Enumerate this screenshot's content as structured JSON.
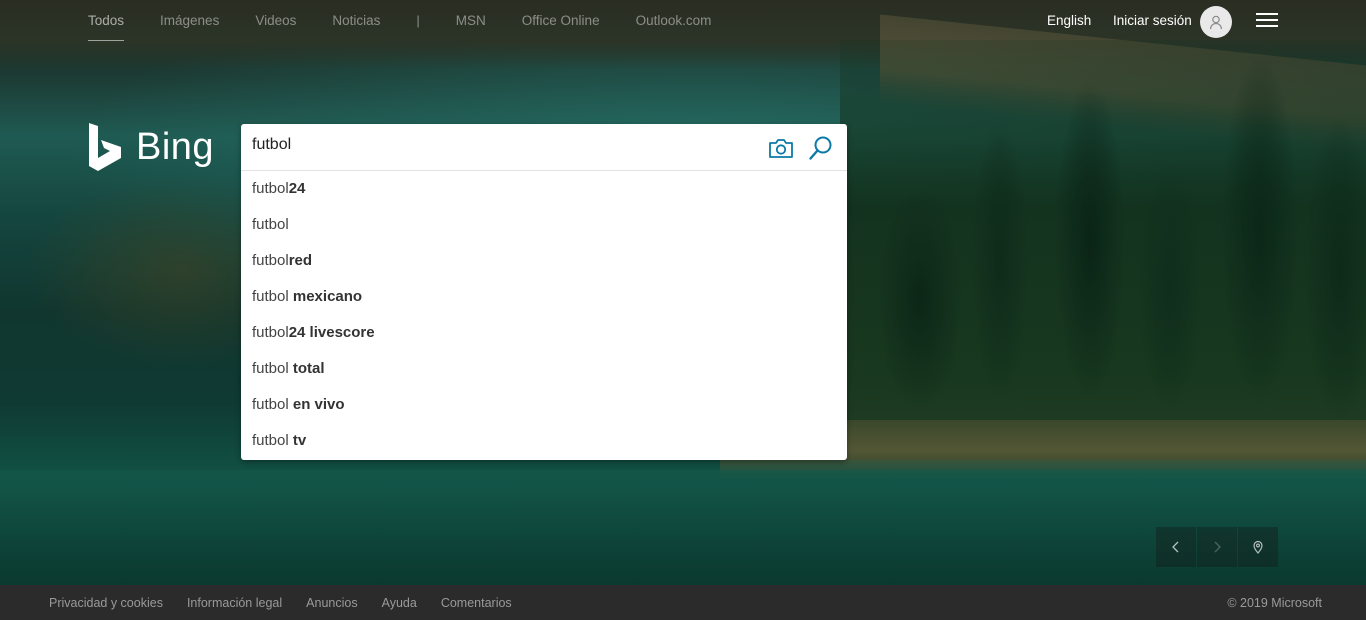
{
  "nav": {
    "items": [
      {
        "label": "Todos",
        "active": true
      },
      {
        "label": "Imágenes"
      },
      {
        "label": "Videos"
      },
      {
        "label": "Noticias"
      },
      {
        "label": "|"
      },
      {
        "label": "MSN"
      },
      {
        "label": "Office Online"
      },
      {
        "label": "Outlook.com"
      }
    ],
    "language": "English",
    "signin": "Iniciar sesión",
    "avatar_icon": "user-icon",
    "menu_icon": "hamburger-icon"
  },
  "logo": {
    "word": "Bing",
    "icon": "bing-logo-icon"
  },
  "search": {
    "value": "futbol",
    "camera_icon": "camera-icon",
    "search_icon": "search-icon",
    "suggestions": [
      {
        "prefix": "futbol",
        "bold": "24"
      },
      {
        "prefix": "futbol",
        "bold": ""
      },
      {
        "prefix": "futbol",
        "bold": "red"
      },
      {
        "prefix": "futbol ",
        "bold": "mexicano"
      },
      {
        "prefix": "futbol",
        "bold": "24 livescore"
      },
      {
        "prefix": "futbol ",
        "bold": "total"
      },
      {
        "prefix": "futbol ",
        "bold": "en vivo"
      },
      {
        "prefix": "futbol ",
        "bold": "tv"
      }
    ]
  },
  "carousel": {
    "prev_icon": "chevron-left-icon",
    "next_icon": "chevron-right-icon",
    "location_icon": "location-pin-icon"
  },
  "footer": {
    "links": [
      "Privacidad y cookies",
      "Información legal",
      "Anuncios",
      "Ayuda",
      "Comentarios"
    ],
    "copyright": "© 2019 Microsoft"
  },
  "colors": {
    "accent": "#0c7aa7",
    "footer_bg": "#2b2b2b"
  }
}
